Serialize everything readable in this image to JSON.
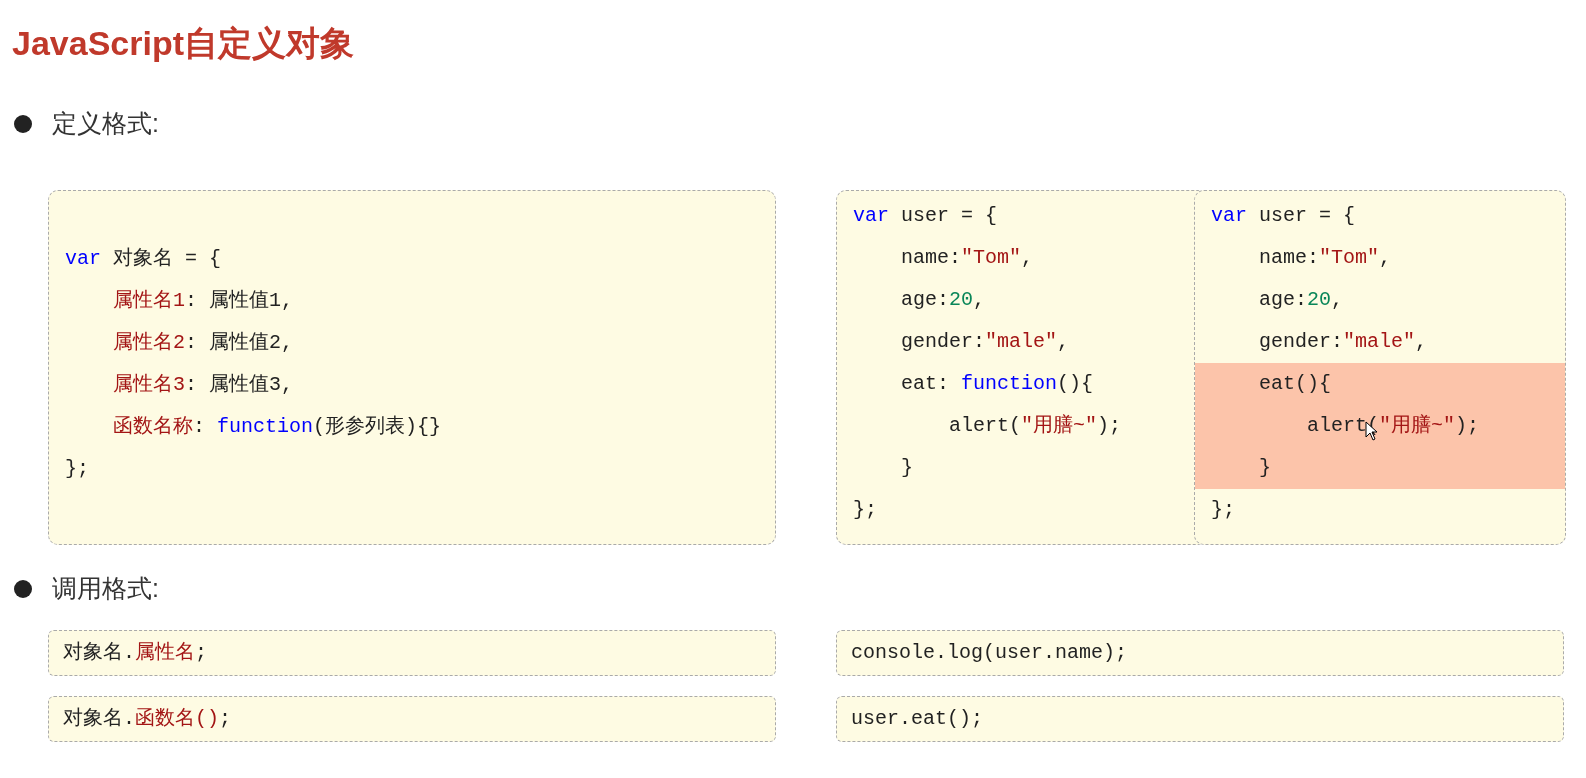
{
  "title": "JavaScript自定义对象",
  "sections": [
    {
      "heading": "定义格式:",
      "blocks": [
        {
          "kind": "tall",
          "lines": [
            {
              "highlighted": false,
              "tokens": [
                {
                  "kind": "keyword",
                  "text": "var"
                },
                {
                  "kind": "plain",
                  "text": " 对象名 = {"
                }
              ]
            },
            {
              "highlighted": false,
              "tokens": [
                {
                  "kind": "property",
                  "text": "    属性名1"
                },
                {
                  "kind": "plain",
                  "text": ": 属性值1,"
                }
              ]
            },
            {
              "highlighted": false,
              "tokens": [
                {
                  "kind": "property",
                  "text": "    属性名2"
                },
                {
                  "kind": "plain",
                  "text": ": 属性值2,"
                }
              ]
            },
            {
              "highlighted": false,
              "tokens": [
                {
                  "kind": "property",
                  "text": "    属性名3"
                },
                {
                  "kind": "plain",
                  "text": ": 属性值3,"
                }
              ]
            },
            {
              "highlighted": false,
              "tokens": [
                {
                  "kind": "property",
                  "text": "    函数名称"
                },
                {
                  "kind": "plain",
                  "text": ": "
                },
                {
                  "kind": "keyword",
                  "text": "function"
                },
                {
                  "kind": "plain",
                  "text": "(形参列表){}"
                }
              ]
            },
            {
              "highlighted": false,
              "tokens": [
                {
                  "kind": "plain",
                  "text": "};"
                }
              ]
            }
          ]
        },
        {
          "kind": "pair",
          "panels": [
            {
              "lines": [
                {
                  "highlighted": false,
                  "tokens": [
                    {
                      "kind": "keyword",
                      "text": "var"
                    },
                    {
                      "kind": "plain",
                      "text": " user = {"
                    }
                  ]
                },
                {
                  "highlighted": false,
                  "tokens": [
                    {
                      "kind": "plain",
                      "text": "    name:"
                    },
                    {
                      "kind": "string",
                      "text": "\"Tom\""
                    },
                    {
                      "kind": "plain",
                      "text": ","
                    }
                  ]
                },
                {
                  "highlighted": false,
                  "tokens": [
                    {
                      "kind": "plain",
                      "text": "    age:"
                    },
                    {
                      "kind": "number",
                      "text": "20"
                    },
                    {
                      "kind": "plain",
                      "text": ","
                    }
                  ]
                },
                {
                  "highlighted": false,
                  "tokens": [
                    {
                      "kind": "plain",
                      "text": "    gender:"
                    },
                    {
                      "kind": "string",
                      "text": "\"male\""
                    },
                    {
                      "kind": "plain",
                      "text": ","
                    }
                  ]
                },
                {
                  "highlighted": false,
                  "tokens": [
                    {
                      "kind": "plain",
                      "text": "    eat: "
                    },
                    {
                      "kind": "keyword",
                      "text": "function"
                    },
                    {
                      "kind": "plain",
                      "text": "(){"
                    }
                  ]
                },
                {
                  "highlighted": false,
                  "tokens": [
                    {
                      "kind": "plain",
                      "text": "        alert("
                    },
                    {
                      "kind": "string",
                      "text": "\"用膳~\""
                    },
                    {
                      "kind": "plain",
                      "text": ");"
                    }
                  ]
                },
                {
                  "highlighted": false,
                  "tokens": [
                    {
                      "kind": "plain",
                      "text": "    }"
                    }
                  ]
                },
                {
                  "highlighted": false,
                  "tokens": [
                    {
                      "kind": "plain",
                      "text": "};"
                    }
                  ]
                }
              ]
            },
            {
              "lines": [
                {
                  "highlighted": false,
                  "tokens": [
                    {
                      "kind": "keyword",
                      "text": "var"
                    },
                    {
                      "kind": "plain",
                      "text": " user = {"
                    }
                  ]
                },
                {
                  "highlighted": false,
                  "tokens": [
                    {
                      "kind": "plain",
                      "text": "    name:"
                    },
                    {
                      "kind": "string",
                      "text": "\"Tom\""
                    },
                    {
                      "kind": "plain",
                      "text": ","
                    }
                  ]
                },
                {
                  "highlighted": false,
                  "tokens": [
                    {
                      "kind": "plain",
                      "text": "    age:"
                    },
                    {
                      "kind": "number",
                      "text": "20"
                    },
                    {
                      "kind": "plain",
                      "text": ","
                    }
                  ]
                },
                {
                  "highlighted": false,
                  "tokens": [
                    {
                      "kind": "plain",
                      "text": "    gender:"
                    },
                    {
                      "kind": "string",
                      "text": "\"male\""
                    },
                    {
                      "kind": "plain",
                      "text": ","
                    }
                  ]
                },
                {
                  "highlighted": true,
                  "tokens": [
                    {
                      "kind": "plain",
                      "text": "    eat(){"
                    }
                  ]
                },
                {
                  "highlighted": true,
                  "tokens": [
                    {
                      "kind": "plain",
                      "text": "        alert("
                    },
                    {
                      "kind": "string",
                      "text": "\"用膳~\""
                    },
                    {
                      "kind": "plain",
                      "text": ");"
                    }
                  ]
                },
                {
                  "highlighted": true,
                  "tokens": [
                    {
                      "kind": "plain",
                      "text": "    }"
                    }
                  ]
                },
                {
                  "highlighted": false,
                  "tokens": [
                    {
                      "kind": "plain",
                      "text": "};"
                    }
                  ]
                }
              ]
            }
          ]
        }
      ]
    },
    {
      "heading": "调用格式:",
      "blocks": [
        {
          "kind": "short",
          "lines": [
            {
              "highlighted": false,
              "tokens": [
                {
                  "kind": "plain",
                  "text": "对象名."
                },
                {
                  "kind": "property",
                  "text": "属性名"
                },
                {
                  "kind": "plain",
                  "text": ";"
                }
              ]
            }
          ]
        },
        {
          "kind": "short",
          "lines": [
            {
              "highlighted": false,
              "tokens": [
                {
                  "kind": "plain",
                  "text": "console.log(user.name);"
                }
              ]
            }
          ]
        },
        {
          "kind": "short",
          "lines": [
            {
              "highlighted": false,
              "tokens": [
                {
                  "kind": "plain",
                  "text": "对象名."
                },
                {
                  "kind": "property",
                  "text": "函数名()"
                },
                {
                  "kind": "plain",
                  "text": ";"
                }
              ]
            }
          ]
        },
        {
          "kind": "short",
          "lines": [
            {
              "highlighted": false,
              "tokens": [
                {
                  "kind": "plain",
                  "text": "user.eat();"
                }
              ]
            }
          ]
        }
      ]
    }
  ]
}
